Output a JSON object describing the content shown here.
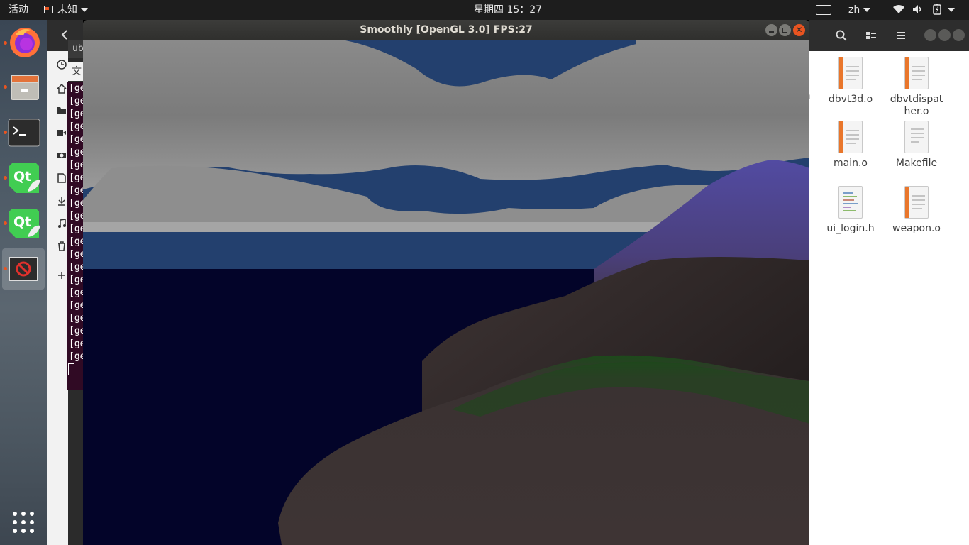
{
  "topbar": {
    "activities": "活动",
    "app_name": "未知",
    "clock": "星期四 15：27",
    "input_method": "zh"
  },
  "dock": {
    "items": [
      {
        "name": "Firefox",
        "icon": "firefox-icon",
        "running": true
      },
      {
        "name": "Files",
        "icon": "files-icon",
        "running": true
      },
      {
        "name": "Terminal",
        "icon": "terminal-icon",
        "running": true
      },
      {
        "name": "Qt Creator",
        "icon": "qt-icon",
        "running": true
      },
      {
        "name": "Qt Creator",
        "icon": "qt-icon",
        "running": true
      },
      {
        "name": "Unknown app",
        "icon": "unknown-app-icon",
        "running": true,
        "active": true
      }
    ],
    "show_apps_icon": "app-grid-icon"
  },
  "terminal": {
    "tab_label": "ub",
    "menu_label": "文",
    "line_prefix": "[ge",
    "line_count": 22
  },
  "file_manager": {
    "partial_label": "a",
    "files": [
      {
        "name": "dbvt3d.o",
        "type": "object"
      },
      {
        "name": "dbvtdispat\nher.o",
        "type": "object"
      },
      {
        "name": "main.o",
        "type": "object"
      },
      {
        "name": "Makefile",
        "type": "text"
      },
      {
        "name": "ui_login.h",
        "type": "code"
      },
      {
        "name": "weapon.o",
        "type": "object"
      }
    ]
  },
  "gl_window": {
    "title": "Smoothly [OpenGL 3.0] FPS:27",
    "colors": {
      "sky": "#23406e",
      "water": "#030429",
      "cloud": "#8f8f8f",
      "hill": "#3e3434",
      "grass": "#1c4a1a",
      "mountain_top": "#524ba2"
    }
  }
}
